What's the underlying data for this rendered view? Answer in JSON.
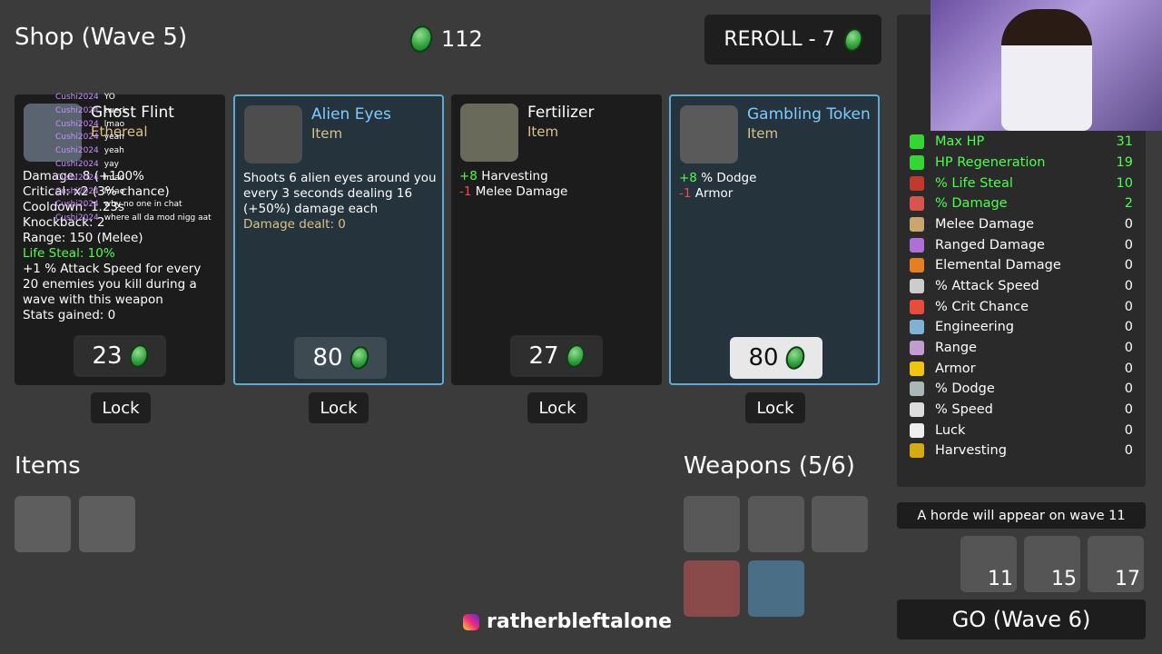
{
  "shop_title": "Shop (Wave 5)",
  "materials": "112",
  "reroll_label": "REROLL - 7",
  "cards": [
    {
      "name": "Ghost Flint",
      "sub": "Ethereal",
      "lines": [
        {
          "t": "Damage: 8 (+100%",
          "c": "normal"
        },
        {
          "t": "Critical: x2 (3% chance)",
          "c": "normal"
        },
        {
          "t": "Cooldown: 1.23s",
          "c": "normal"
        },
        {
          "t": "Knockback: 2",
          "c": "normal"
        },
        {
          "t": "Range: 150 (Melee)",
          "c": "normal"
        },
        {
          "t": "Life Steal: 10%",
          "c": "green"
        },
        {
          "t": "+1 % Attack Speed for every 20 enemies you kill during a wave with this weapon",
          "c": "green"
        },
        {
          "t": "Stats gained: 0",
          "c": "tan"
        }
      ],
      "price": "23",
      "lock": "Lock"
    },
    {
      "name": "Alien Eyes",
      "sub": "Item",
      "desc": "Shoots 6 alien eyes around you every 3 seconds dealing 16 (+50%) damage each",
      "extra": "Damage dealt: 0",
      "price": "80",
      "lock": "Lock"
    },
    {
      "name": "Fertilizer",
      "sub": "Item",
      "mods": [
        {
          "v": "+8",
          "s": "Harvesting",
          "c": "green"
        },
        {
          "v": "-1",
          "s": "Melee Damage",
          "c": "red"
        }
      ],
      "price": "27",
      "lock": "Lock"
    },
    {
      "name": "Gambling Token",
      "sub": "Item",
      "mods": [
        {
          "v": "+8",
          "s": "% Dodge",
          "c": "green"
        },
        {
          "v": "-1",
          "s": "Armor",
          "c": "red"
        }
      ],
      "price": "80",
      "lock": "Lock"
    }
  ],
  "items_title": "Items",
  "weapons_title": "Weapons (5/6)",
  "stats": [
    {
      "label": "Max HP",
      "value": "31",
      "hl": true,
      "color": "#33d633"
    },
    {
      "label": "HP Regeneration",
      "value": "19",
      "hl": true,
      "color": "#33d633"
    },
    {
      "label": "% Life Steal",
      "value": "10",
      "hl": true,
      "color": "#c0392b"
    },
    {
      "label": "% Damage",
      "value": "2",
      "hl": true,
      "color": "#d9534f"
    },
    {
      "label": "Melee Damage",
      "value": "0",
      "hl": false,
      "color": "#c9a66b"
    },
    {
      "label": "Ranged Damage",
      "value": "0",
      "hl": false,
      "color": "#b06fd6"
    },
    {
      "label": "Elemental Damage",
      "value": "0",
      "hl": false,
      "color": "#e67e22"
    },
    {
      "label": "% Attack Speed",
      "value": "0",
      "hl": false,
      "color": "#cccccc"
    },
    {
      "label": "% Crit Chance",
      "value": "0",
      "hl": false,
      "color": "#e74c3c"
    },
    {
      "label": "Engineering",
      "value": "0",
      "hl": false,
      "color": "#7fb3d5"
    },
    {
      "label": "Range",
      "value": "0",
      "hl": false,
      "color": "#c39bd3"
    },
    {
      "label": "Armor",
      "value": "0",
      "hl": false,
      "color": "#f1c40f"
    },
    {
      "label": "% Dodge",
      "value": "0",
      "hl": false,
      "color": "#aab7b8"
    },
    {
      "label": "% Speed",
      "value": "0",
      "hl": false,
      "color": "#dddddd"
    },
    {
      "label": "Luck",
      "value": "0",
      "hl": false,
      "color": "#eeeeee"
    },
    {
      "label": "Harvesting",
      "value": "0",
      "hl": false,
      "color": "#d4ac0d"
    }
  ],
  "horde_text": "A horde will appear on wave 11",
  "enemy_waves": [
    "11",
    "15",
    "17"
  ],
  "go_label": "GO (Wave 6)",
  "chat": [
    {
      "user": "Cushi2024",
      "msg": "YO"
    },
    {
      "user": "Cushi2024",
      "msg": "twerk"
    },
    {
      "user": "Cushi2024",
      "msg": "lmao"
    },
    {
      "user": "Cushi2024",
      "msg": "yeah"
    },
    {
      "user": "Cushi2024",
      "msg": "yeah"
    },
    {
      "user": "Cushi2024",
      "msg": "yay"
    },
    {
      "user": "Cushi2024",
      "msg": "lmao"
    },
    {
      "user": "Cushi2024",
      "msg": "lmao"
    },
    {
      "user": "Cushi2024",
      "msg": "why no one in chat"
    },
    {
      "user": "Cushi2024",
      "msg": "where all da mod nigg aat"
    }
  ],
  "handle": "ratherbleftalone",
  "colors": {
    "accent_blue": "#5fa9d6",
    "material_green": "#2f9e3a"
  }
}
